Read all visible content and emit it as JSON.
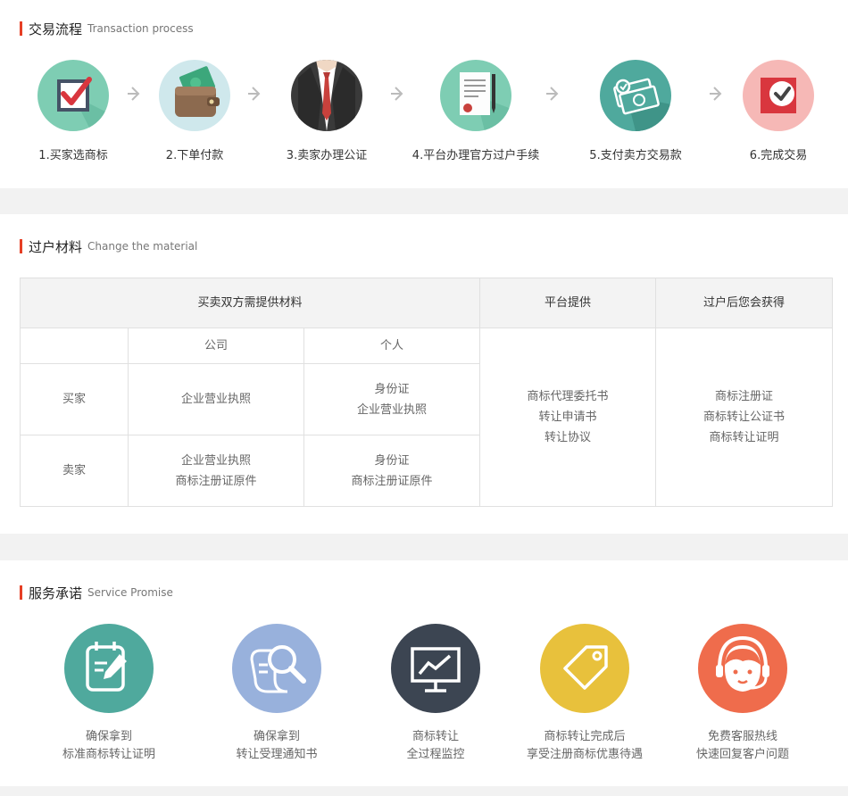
{
  "process": {
    "title": "交易流程",
    "subtitle": "Transaction process",
    "steps": [
      {
        "label": "1.买家选商标",
        "icon": "checkbox-icon",
        "color": "#7ecdb3"
      },
      {
        "label": "2.下单付款",
        "icon": "wallet-icon",
        "color": "#cfe8ec"
      },
      {
        "label": "3.卖家办理公证",
        "icon": "suit-icon",
        "color": "#3a3a3a"
      },
      {
        "label": "4.平台办理官方过户手续",
        "icon": "document-icon",
        "color": "#7ecdb3"
      },
      {
        "label": "5.支付卖方交易款",
        "icon": "money-icon",
        "color": "#4fa99d"
      },
      {
        "label": "6.完成交易",
        "icon": "done-icon",
        "color": "#f6b8b6"
      }
    ]
  },
  "material": {
    "title": "过户材料",
    "subtitle": "Change the material",
    "headers": {
      "both_parties": "买卖双方需提供材料",
      "platform": "平台提供",
      "after": "过户后您会获得"
    },
    "subheaders": {
      "company": "公司",
      "individual": "个人"
    },
    "buyer": {
      "label": "买家",
      "company": "企业营业执照",
      "individual_1": "身份证",
      "individual_2": "企业营业执照"
    },
    "seller": {
      "label": "卖家",
      "company_1": "企业营业执照",
      "company_2": "商标注册证原件",
      "individual_1": "身份证",
      "individual_2": "商标注册证原件"
    },
    "platform": [
      "商标代理委托书",
      "转让申请书",
      "转让协议"
    ],
    "after": [
      "商标注册证",
      "商标转让公证书",
      "商标转让证明"
    ]
  },
  "promise": {
    "title": "服务承诺",
    "subtitle": "Service Promise",
    "items": [
      {
        "line1": "确保拿到",
        "line2": "标准商标转让证明",
        "icon": "notepad-icon",
        "color": "#4fa99d"
      },
      {
        "line1": "确保拿到",
        "line2": "转让受理通知书",
        "icon": "magnifier-icon",
        "color": "#98b1dc"
      },
      {
        "line1": "商标转让",
        "line2": "全过程监控",
        "icon": "monitor-icon",
        "color": "#3c4552"
      },
      {
        "line1": "商标转让完成后",
        "line2": "享受注册商标优惠待遇",
        "icon": "tag-icon",
        "color": "#e8c13c"
      },
      {
        "line1": "免费客服热线",
        "line2": "快速回复客户问题",
        "icon": "headset-icon",
        "color": "#ef6c4c"
      }
    ]
  }
}
